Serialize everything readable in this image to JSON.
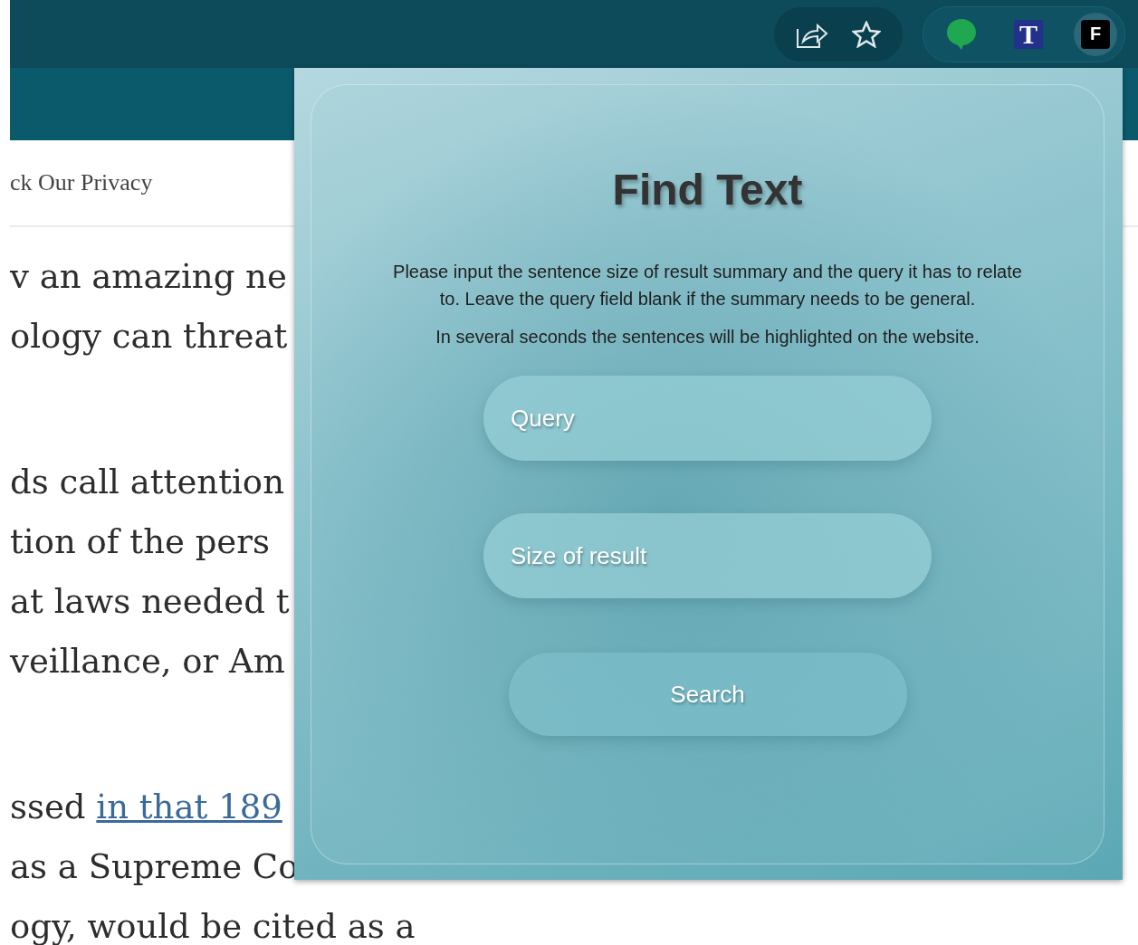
{
  "browser": {
    "extensions": [
      {
        "kind": "bubble",
        "active": false
      },
      {
        "kind": "serif-letter",
        "label": "T",
        "active": false
      },
      {
        "kind": "block-letter",
        "label": "F",
        "active": true
      }
    ]
  },
  "site": {
    "nav_text": "ck Our Privacy"
  },
  "article": {
    "paragraphs": [
      [
        {
          "text": "v an amazing ne"
        },
        {
          "text": "ology can threat"
        }
      ],
      [
        {
          "text": "ds call attention"
        },
        {
          "text": "tion of the pers"
        },
        {
          "text": "at laws needed t"
        },
        {
          "text": "veillance, or Am"
        }
      ],
      [
        {
          "text": "ssed ",
          "link": "in that 189"
        },
        {
          "text": "as a Supreme Co"
        },
        {
          "text": "ogy, would be cited as a"
        }
      ]
    ]
  },
  "popup": {
    "title": "Find Text",
    "instructions": [
      "Please input the sentence size of result summary and the query it has to relate to. Leave the query field blank if the summary needs to be general.",
      "In several seconds the sentences will be highlighted on the website."
    ],
    "query_field": {
      "placeholder": "Query"
    },
    "size_field": {
      "placeholder": "Size of result"
    },
    "search_button": "Search"
  }
}
